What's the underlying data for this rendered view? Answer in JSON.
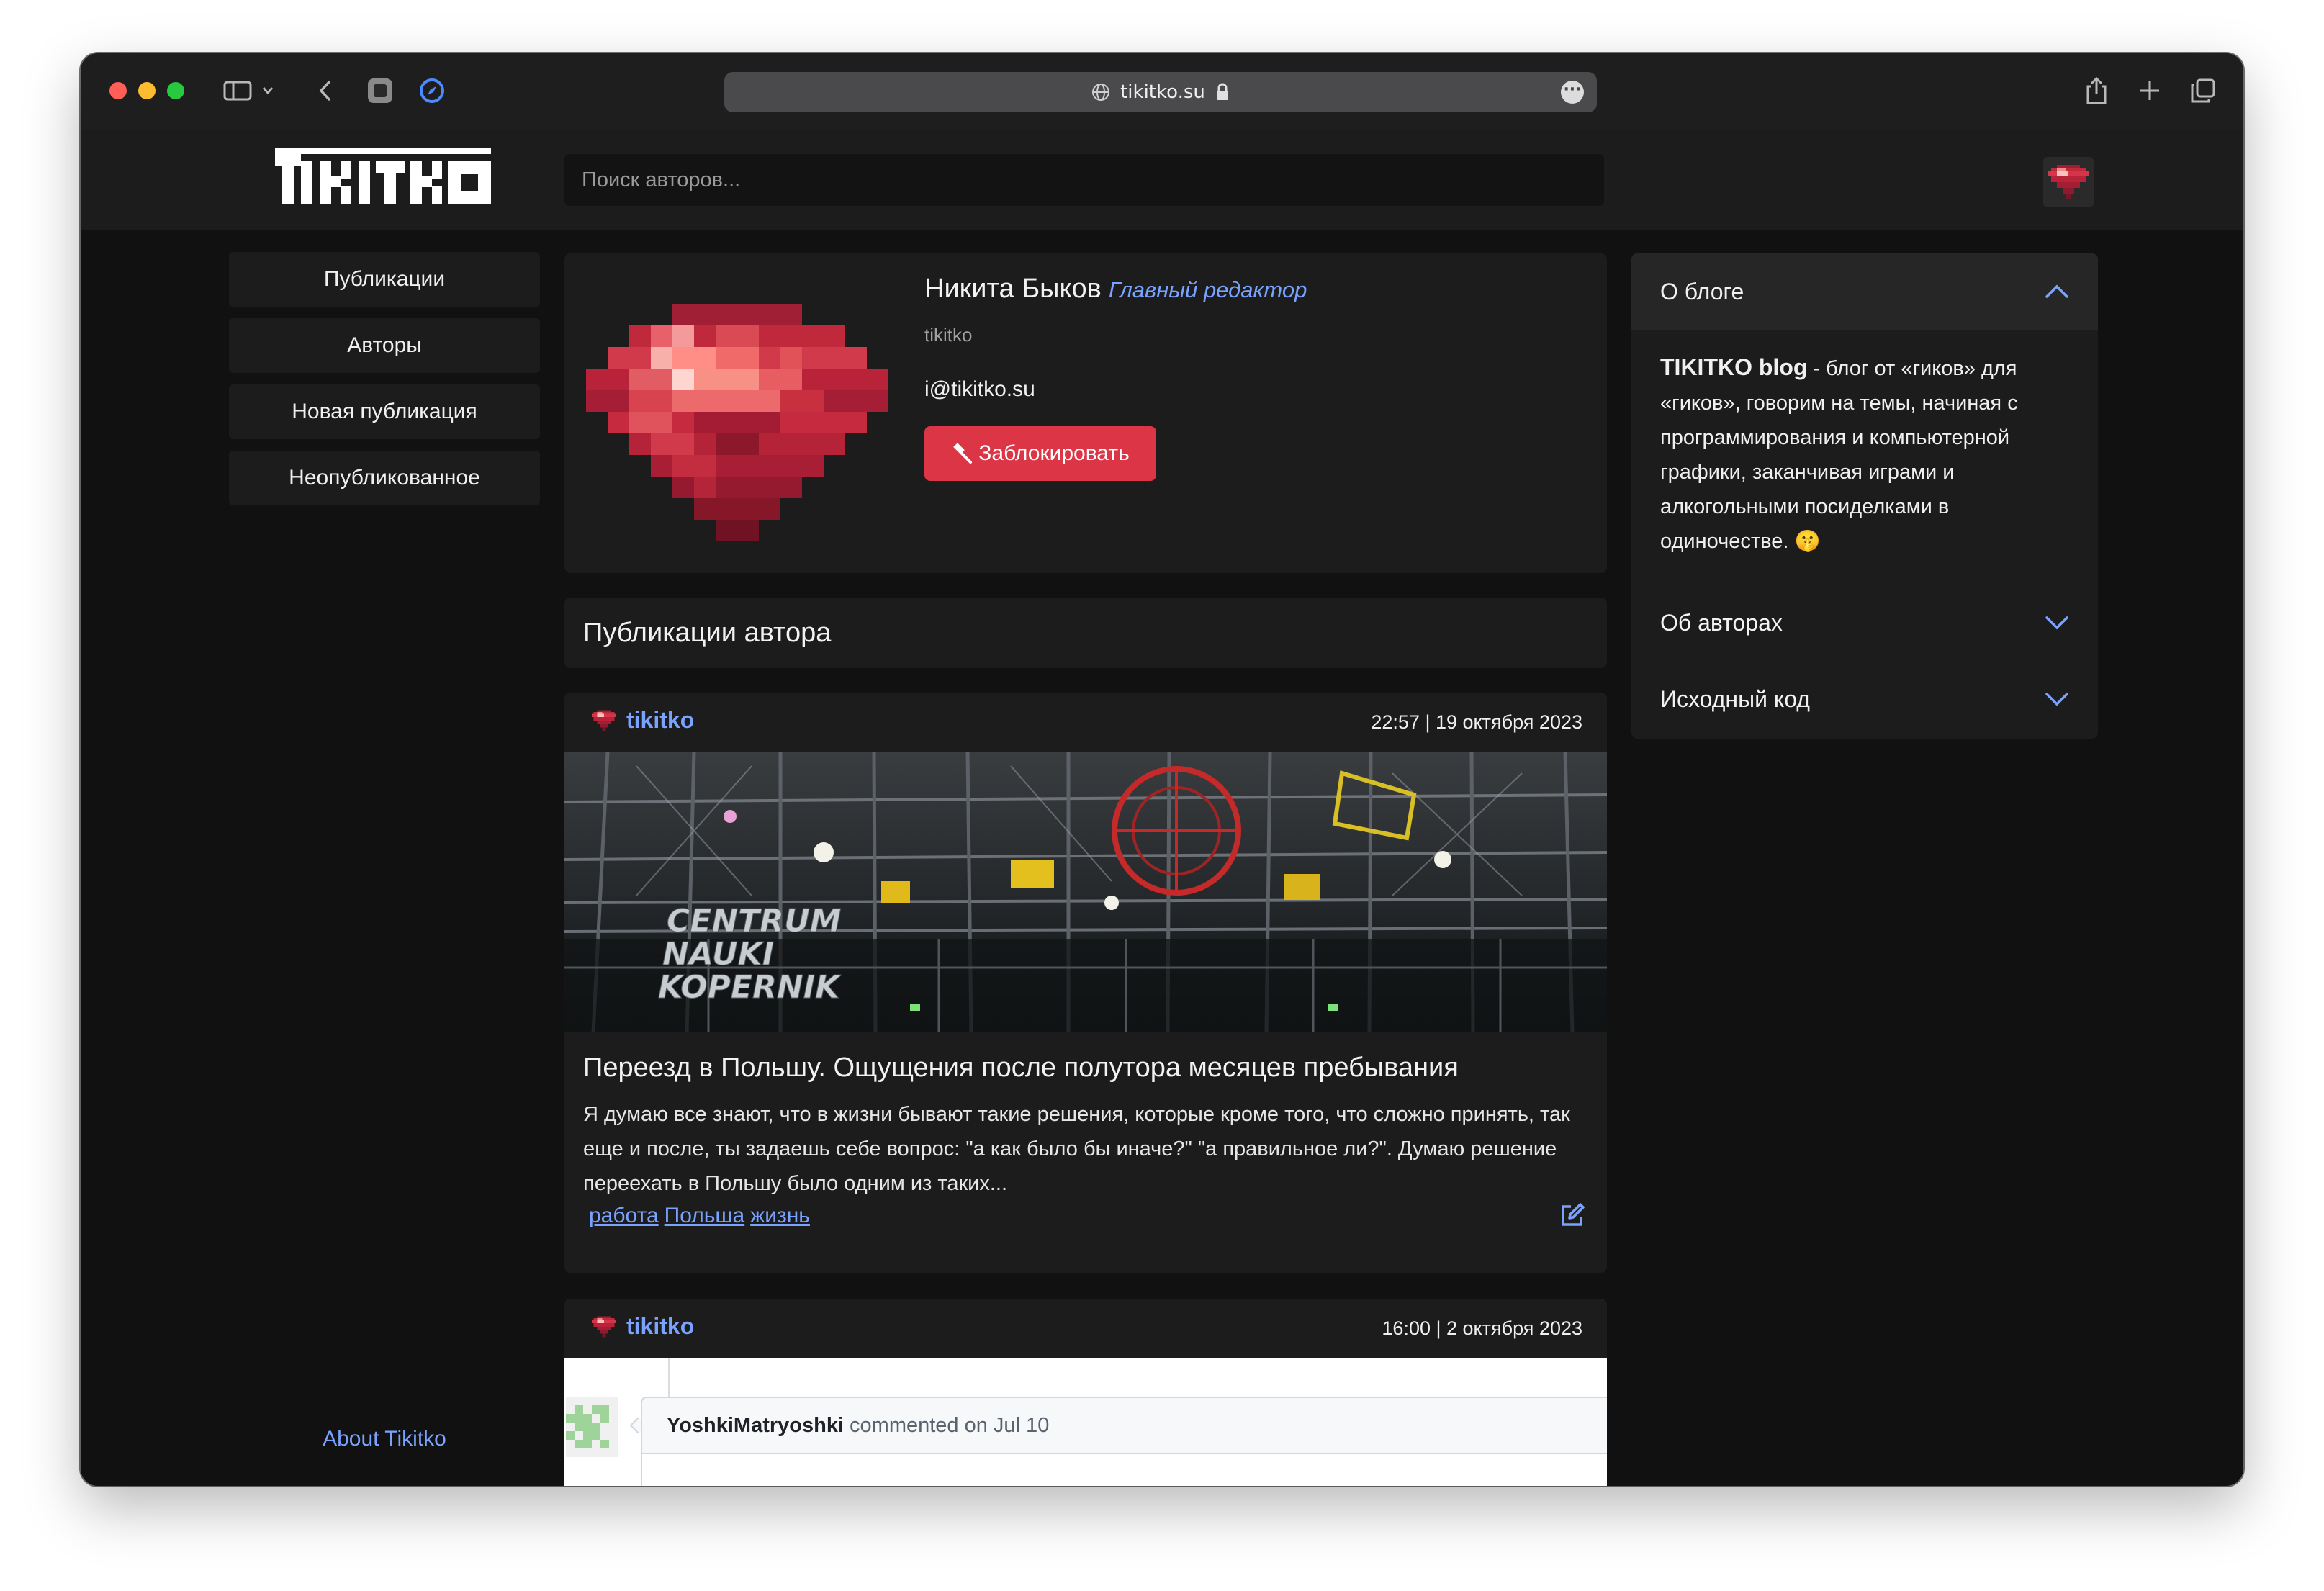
{
  "browser": {
    "url": "tikitko.su"
  },
  "header": {
    "search_placeholder": "Поиск авторов..."
  },
  "nav": {
    "items": [
      "Публикации",
      "Авторы",
      "Новая публикация",
      "Неопубликованное"
    ],
    "about": "About Tikitko"
  },
  "profile": {
    "name": "Никита Быков",
    "role": "Главный редактор",
    "login": "tikitko",
    "email": "i@tikitko.su",
    "block_button": "Заблокировать"
  },
  "section": {
    "title": "Публикации автора"
  },
  "posts": [
    {
      "author": "tikitko",
      "date": "22:57 | 19 октября 2023",
      "image_text": [
        "CENTRUM",
        "NAUKI",
        "KOPERNIK"
      ],
      "title": "Переезд в Польшу. Ощущения после полутора месяцев пребывания",
      "excerpt": "Я думаю все знают, что в жизни бывают такие решения, которые кроме того, что сложно принять, так еще и после, ты задаешь себе вопрос: \"а как было бы иначе?\" \"а правильное ли?\". Думаю решение переехать в Польшу было одним из таких...",
      "tags": [
        "работа",
        "Польша",
        "жизнь"
      ]
    },
    {
      "author": "tikitko",
      "date": "16:00 | 2 октября 2023",
      "comment_user": "YoshkiMatryoshki",
      "comment_meta": "commented on Jul 10"
    }
  ],
  "sidebar": {
    "sections": [
      {
        "title": "О блоге",
        "expanded": true
      },
      {
        "title": "Об авторах",
        "expanded": false
      },
      {
        "title": "Исходный код",
        "expanded": false
      }
    ],
    "about_bold": "TIKITKO blog",
    "about_text": " - блог от «гиков» для «гиков», говорим на темы, начиная с программирования и компьютерной графики, заканчивая играми и алкогольными посиделками в одиночестве. 🤫"
  },
  "colors": {
    "accent": "#7aa2ff",
    "danger": "#dc3545",
    "ruby": "#c0283c",
    "background": "#111111",
    "card": "#1c1c1c"
  }
}
